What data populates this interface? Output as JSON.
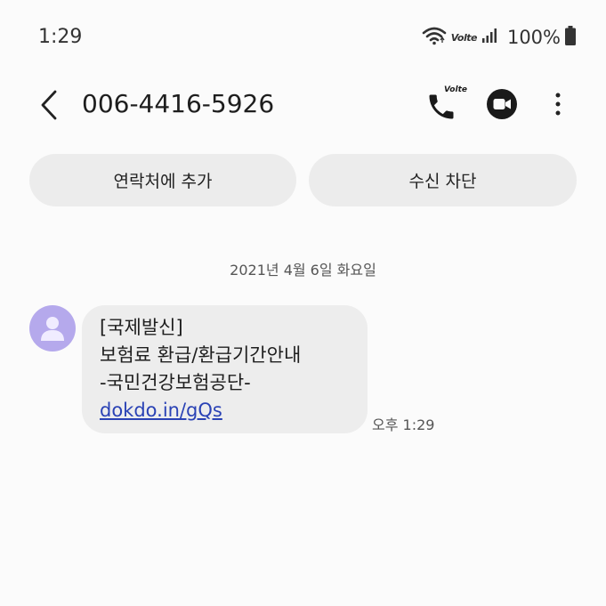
{
  "status_bar": {
    "time": "1:29",
    "volte": "Volte",
    "battery": "100%"
  },
  "header": {
    "number": "006-4416-5926",
    "call_tag": "Volte",
    "icons": [
      "back-icon",
      "phone-icon",
      "video-call-icon",
      "more-icon"
    ]
  },
  "actions": {
    "add_contact": "연락처에 추가",
    "block": "수신 차단"
  },
  "conversation": {
    "date": "2021년 4월 6일 화요일",
    "messages": [
      {
        "lines": [
          "[국제발신]",
          "보험료 환급/환급기간안내",
          "-국민건강보험공단-"
        ],
        "link": "dokdo.in/gQs",
        "time": "오후 1:29"
      }
    ]
  },
  "colors": {
    "background": "#fbfbfb",
    "button_bg": "#ececec",
    "bubble_bg": "#ededed",
    "avatar_bg": "#b5a9ec",
    "link": "#2a42b5"
  }
}
